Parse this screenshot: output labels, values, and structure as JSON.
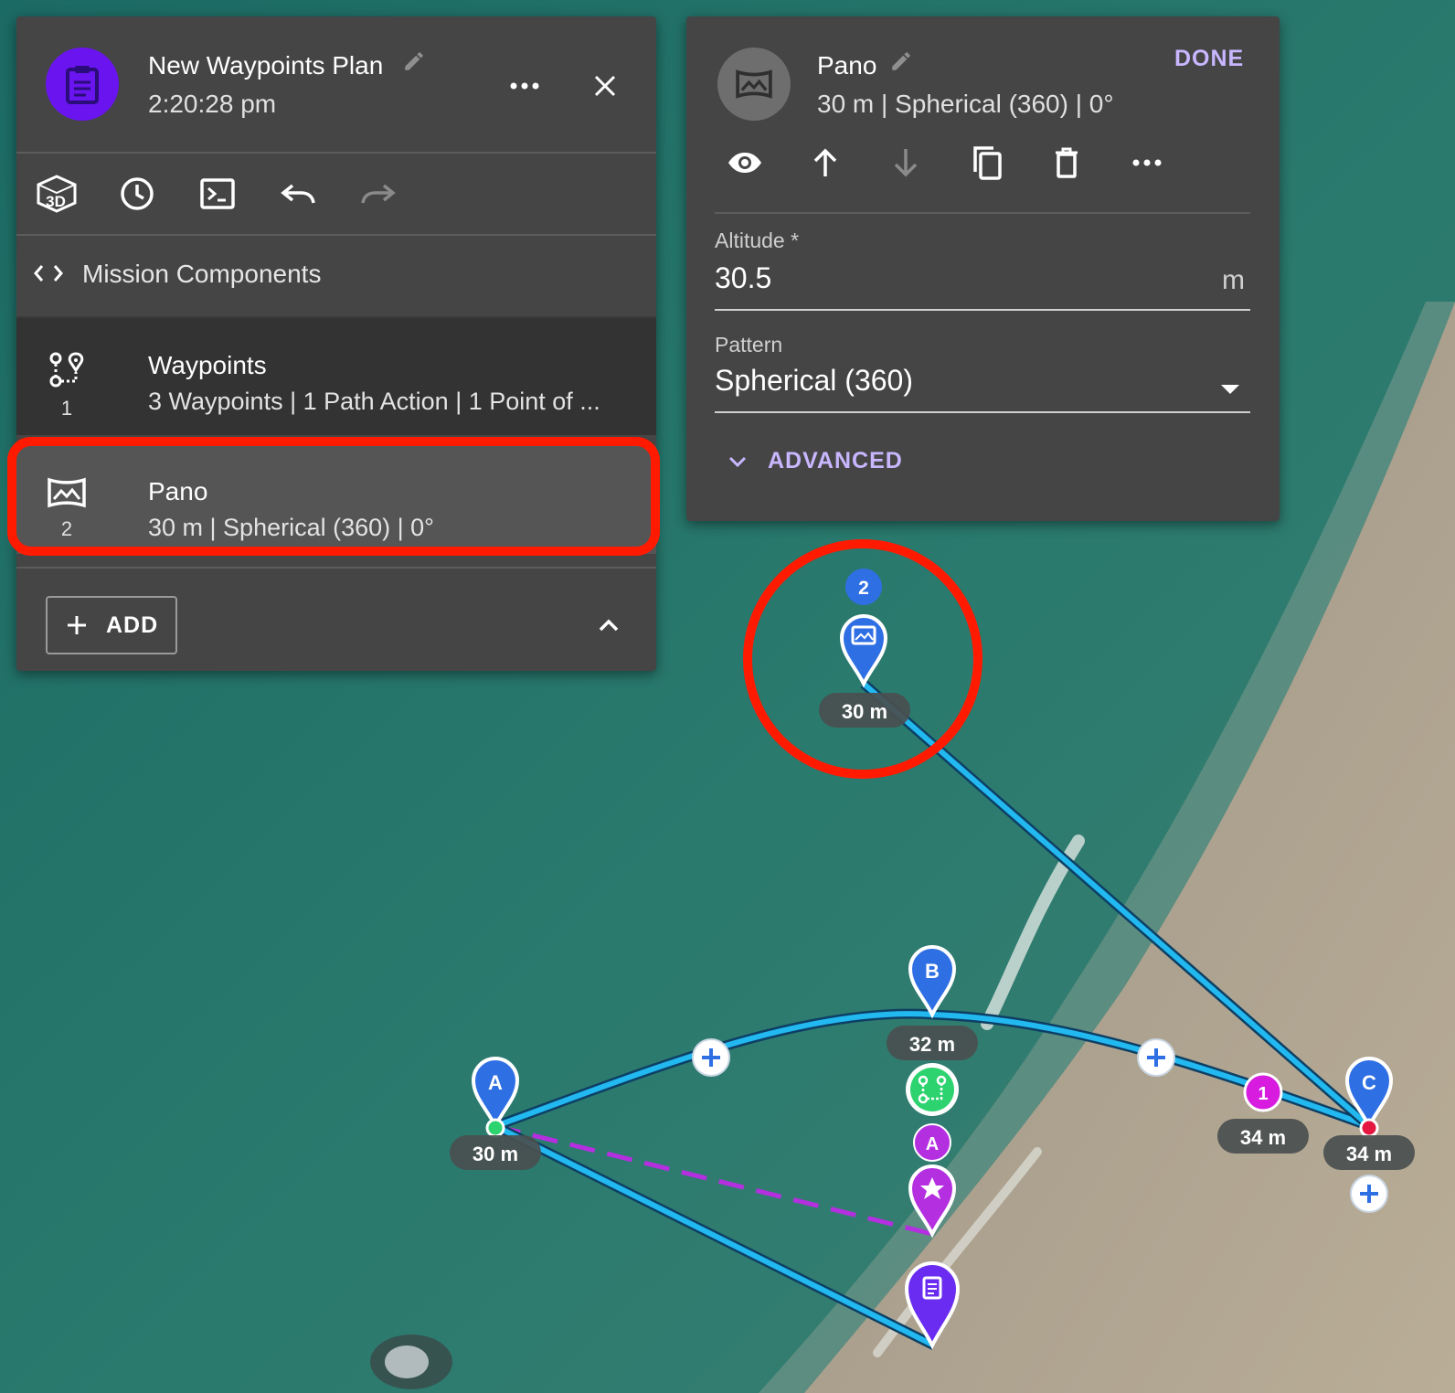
{
  "plan": {
    "title": "New Waypoints Plan",
    "time": "2:20:28 pm",
    "toolbar": [
      "3d-view-icon",
      "history-icon",
      "terminal-icon",
      "undo-icon",
      "redo-icon"
    ]
  },
  "components": {
    "label": "Mission Components",
    "items": [
      {
        "title": "Waypoints",
        "subtitle": "3 Waypoints | 1 Path Action | 1 Point of ...",
        "index": "1",
        "icon": "waypoints-route-icon"
      },
      {
        "title": "Pano",
        "subtitle": "30 m | Spherical (360) | 0°",
        "index": "2",
        "icon": "panorama-icon"
      }
    ],
    "add_label": "ADD"
  },
  "detail": {
    "title": "Pano",
    "subtitle": "30 m | Spherical (360) | 0°",
    "done_label": "DONE",
    "actions": [
      "visibility-icon",
      "move-up-icon",
      "move-down-icon",
      "duplicate-icon",
      "delete-icon",
      "more-icon"
    ],
    "altitude": {
      "label": "Altitude *",
      "value": "30.5",
      "unit": "m"
    },
    "pattern": {
      "label": "Pattern",
      "value": "Spherical (360)"
    },
    "advanced_label": "ADVANCED"
  },
  "map": {
    "waypoints": [
      {
        "letter": "A",
        "label": "30 m"
      },
      {
        "letter": "B",
        "label": "32 m"
      },
      {
        "letter": "C",
        "label": "34 m"
      }
    ],
    "pano_marker": {
      "badge": "2",
      "label": "30 m"
    },
    "path_action": {
      "badge": "1",
      "label": "34 m"
    },
    "poi_badge": "A",
    "colors": {
      "path": "#22b8f0",
      "poi_line": "#b42fe0",
      "waypoint_pin": "#2f6fe4",
      "pano_pin": "#2f6fe4",
      "poi_pin": "#b42fe0",
      "plan_pin": "#6a2cf0",
      "highlight": "#ff1a00",
      "accent": "#c8b6ff"
    }
  }
}
